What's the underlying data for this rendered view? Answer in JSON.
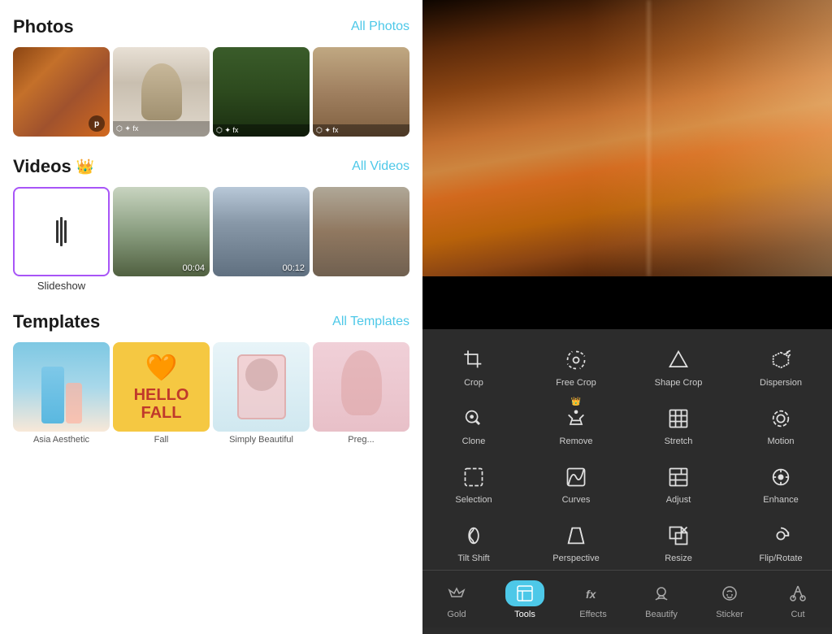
{
  "left": {
    "photos_title": "Photos",
    "all_photos": "All Photos",
    "videos_title": "Videos",
    "all_videos": "All Videos",
    "templates_title": "Templates",
    "all_templates": "All Templates",
    "slideshow_label": "Slideshow",
    "video_duration_1": "00:04",
    "video_duration_2": "00:12",
    "template_labels": [
      "Asia Aesthetic",
      "Fall",
      "Simply Beautiful",
      "Preg"
    ]
  },
  "right": {
    "tools": [
      {
        "id": "crop",
        "label": "Crop",
        "icon": "crop"
      },
      {
        "id": "free-crop",
        "label": "Free Crop",
        "icon": "free-crop"
      },
      {
        "id": "shape-crop",
        "label": "Shape Crop",
        "icon": "shape-crop"
      },
      {
        "id": "dispersion",
        "label": "Dispersion",
        "icon": "dispersion"
      },
      {
        "id": "clone",
        "label": "Clone",
        "icon": "clone"
      },
      {
        "id": "remove",
        "label": "Remove",
        "icon": "remove",
        "crown": true
      },
      {
        "id": "stretch",
        "label": "Stretch",
        "icon": "stretch"
      },
      {
        "id": "motion",
        "label": "Motion",
        "icon": "motion"
      },
      {
        "id": "selection",
        "label": "Selection",
        "icon": "selection"
      },
      {
        "id": "curves",
        "label": "Curves",
        "icon": "curves"
      },
      {
        "id": "adjust",
        "label": "Adjust",
        "icon": "adjust"
      },
      {
        "id": "enhance",
        "label": "Enhance",
        "icon": "enhance"
      },
      {
        "id": "tilt-shift",
        "label": "Tilt Shift",
        "icon": "tilt-shift"
      },
      {
        "id": "perspective",
        "label": "Perspective",
        "icon": "perspective"
      },
      {
        "id": "resize",
        "label": "Resize",
        "icon": "resize"
      },
      {
        "id": "flip-rotate",
        "label": "Flip/Rotate",
        "icon": "flip-rotate"
      }
    ],
    "nav": [
      {
        "id": "gold",
        "label": "Gold",
        "icon": "crown"
      },
      {
        "id": "tools",
        "label": "Tools",
        "icon": "crop-box",
        "active": true
      },
      {
        "id": "effects",
        "label": "Effects",
        "icon": "fx"
      },
      {
        "id": "beautify",
        "label": "Beautify",
        "icon": "face"
      },
      {
        "id": "sticker",
        "label": "Sticker",
        "icon": "sticker"
      },
      {
        "id": "cut",
        "label": "Cut",
        "icon": "cut"
      }
    ]
  }
}
